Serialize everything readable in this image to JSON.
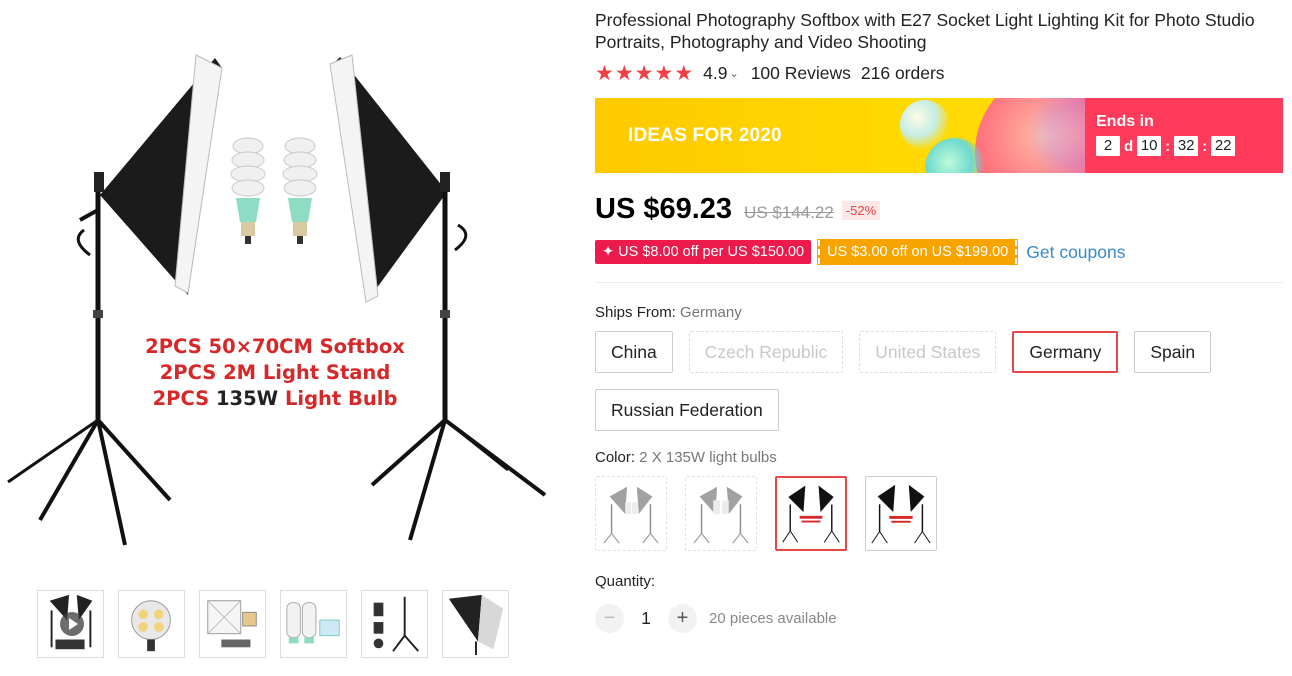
{
  "gallery": {
    "promo_lines": [
      "2PCS 50×70CM Softbox",
      "2PCS 2M Light Stand",
      "2PCS ",
      "135W",
      " Light Bulb"
    ],
    "thumbnails": [
      "video-thumbnail",
      "socket-thumbnail",
      "softbox-thumbnail",
      "bulbs-thumbnail",
      "stand-parts-thumbnail",
      "softbox-side-thumbnail"
    ]
  },
  "product": {
    "title": "Professional Photography Softbox with E27 Socket Light Lighting Kit for Photo Studio Portraits, Photography and Video Shooting",
    "rating": "4.9",
    "reviews": "100 Reviews",
    "orders": "216 orders",
    "star_color": "#f23f44"
  },
  "banner": {
    "text": "IDEAS FOR 2020",
    "ends_in": "Ends in",
    "days": "2",
    "days_unit": "d",
    "hours": "10",
    "minutes": "32",
    "seconds": "22",
    "countdown_color": "#ff3b5c"
  },
  "price": {
    "current": "US $69.23",
    "original": "US $144.22",
    "discount": "-52%"
  },
  "coupons": {
    "coupon1": "✦ US $8.00 off per US $150.00",
    "coupon2": "US $3.00 off on US $199.00",
    "get_coupons": "Get coupons"
  },
  "ships_from": {
    "label": "Ships From: ",
    "value": "Germany",
    "options": [
      {
        "label": "China",
        "state": "normal"
      },
      {
        "label": "Czech Republic",
        "state": "disabled"
      },
      {
        "label": "United States",
        "state": "disabled"
      },
      {
        "label": "Germany",
        "state": "selected"
      },
      {
        "label": "Spain",
        "state": "normal"
      },
      {
        "label": "Russian Federation",
        "state": "normal"
      }
    ]
  },
  "color": {
    "label": "Color: ",
    "value": "2 X 135W light bulbs",
    "swatch_states": [
      "disabled",
      "disabled",
      "selected",
      "normal"
    ]
  },
  "quantity": {
    "label": "Quantity:",
    "value": "1",
    "minus": "−",
    "plus": "+",
    "available": "20 pieces available"
  }
}
